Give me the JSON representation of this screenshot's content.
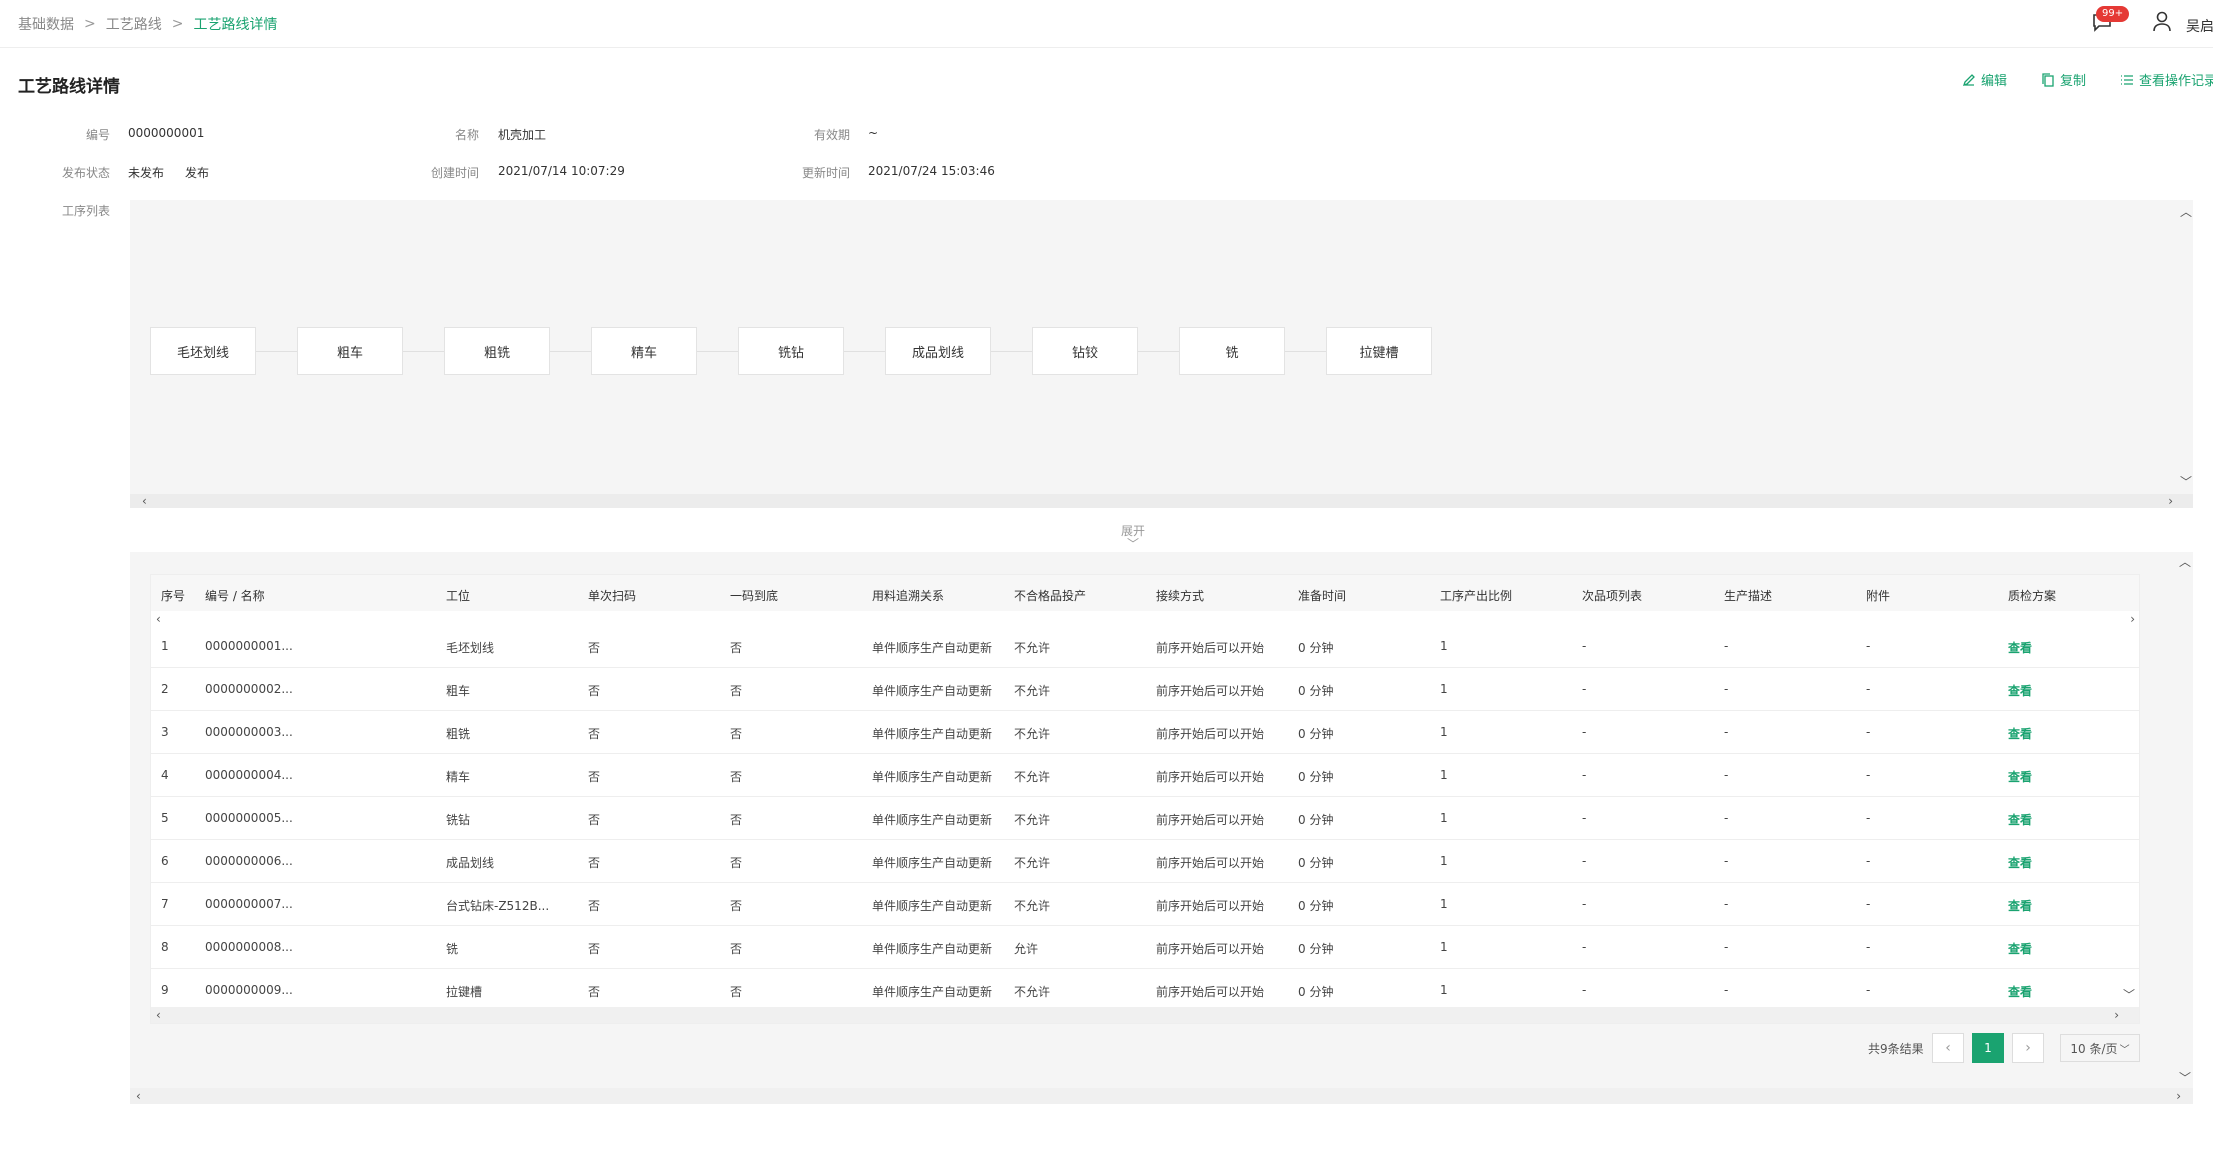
{
  "breadcrumb": [
    "基础数据",
    "工艺路线",
    "工艺路线详情"
  ],
  "breadcrumb_sep": ">",
  "header": {
    "badge": "99+",
    "user_name": "吴启"
  },
  "page_title": "工艺路线详情",
  "actions": {
    "edit": "编辑",
    "copy": "复制",
    "log": "查看操作记录"
  },
  "info": {
    "code_label": "编号",
    "code_value": "0000000001",
    "name_label": "名称",
    "name_value": "机壳加工",
    "validity_label": "有效期",
    "validity_value": "~",
    "status_label": "发布状态",
    "status_value": "未发布",
    "publish_link": "发布",
    "created_label": "创建时间",
    "created_value": "2021/07/14 10:07:29",
    "updated_label": "更新时间",
    "updated_value": "2021/07/24 15:03:46",
    "process_list_label": "工序列表"
  },
  "flow_nodes": [
    "毛坯划线",
    "粗车",
    "粗铣",
    "精车",
    "铣钻",
    "成品划线",
    "钻铰",
    "铣",
    "拉键槽"
  ],
  "expand_label": "展开",
  "table": {
    "headers": [
      "序号",
      "编号 / 名称",
      "工位",
      "单次扫码",
      "一码到底",
      "用料追溯关系",
      "不合格品投产",
      "接续方式",
      "准备时间",
      "工序产出比例",
      "次品项列表",
      "生产描述",
      "附件",
      "质检方案"
    ],
    "rows": [
      [
        "1",
        "0000000001...",
        "毛坯划线",
        "否",
        "否",
        "单件顺序生产自动更新",
        "不允许",
        "前序开始后可以开始",
        "0 分钟",
        "1",
        "-",
        "-",
        "-",
        "查看"
      ],
      [
        "2",
        "0000000002...",
        "粗车",
        "否",
        "否",
        "单件顺序生产自动更新",
        "不允许",
        "前序开始后可以开始",
        "0 分钟",
        "1",
        "-",
        "-",
        "-",
        "查看"
      ],
      [
        "3",
        "0000000003...",
        "粗铣",
        "否",
        "否",
        "单件顺序生产自动更新",
        "不允许",
        "前序开始后可以开始",
        "0 分钟",
        "1",
        "-",
        "-",
        "-",
        "查看"
      ],
      [
        "4",
        "0000000004...",
        "精车",
        "否",
        "否",
        "单件顺序生产自动更新",
        "不允许",
        "前序开始后可以开始",
        "0 分钟",
        "1",
        "-",
        "-",
        "-",
        "查看"
      ],
      [
        "5",
        "0000000005...",
        "铣钻",
        "否",
        "否",
        "单件顺序生产自动更新",
        "不允许",
        "前序开始后可以开始",
        "0 分钟",
        "1",
        "-",
        "-",
        "-",
        "查看"
      ],
      [
        "6",
        "0000000006...",
        "成品划线",
        "否",
        "否",
        "单件顺序生产自动更新",
        "不允许",
        "前序开始后可以开始",
        "0 分钟",
        "1",
        "-",
        "-",
        "-",
        "查看"
      ],
      [
        "7",
        "0000000007...",
        "台式钻床-Z512B...",
        "否",
        "否",
        "单件顺序生产自动更新",
        "不允许",
        "前序开始后可以开始",
        "0 分钟",
        "1",
        "-",
        "-",
        "-",
        "查看"
      ],
      [
        "8",
        "0000000008...",
        "铣",
        "否",
        "否",
        "单件顺序生产自动更新",
        "允许",
        "前序开始后可以开始",
        "0 分钟",
        "1",
        "-",
        "-",
        "-",
        "查看"
      ],
      [
        "9",
        "0000000009...",
        "拉键槽",
        "否",
        "否",
        "单件顺序生产自动更新",
        "不允许",
        "前序开始后可以开始",
        "0 分钟",
        "1",
        "-",
        "-",
        "-",
        "查看"
      ]
    ]
  },
  "pagination": {
    "total": "共9条结果",
    "current": "1",
    "page_size": "10 条/页"
  }
}
